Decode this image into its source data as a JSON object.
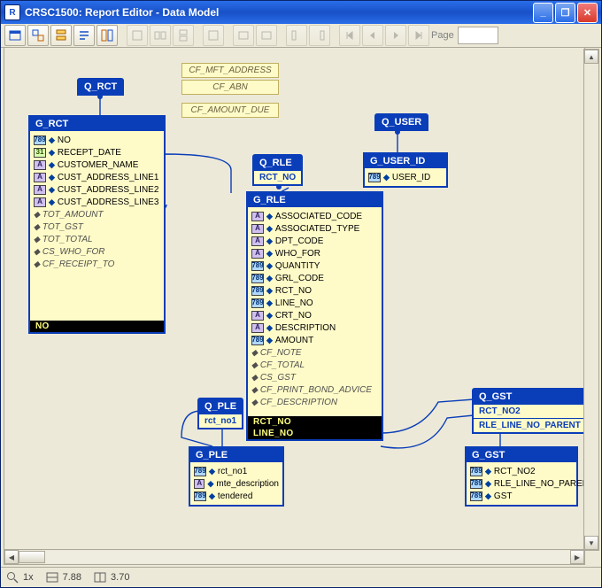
{
  "window": {
    "title": "CRSC1500: Report Editor - Data Model"
  },
  "toolbar": {
    "page_label": "Page"
  },
  "fields": {
    "f1": "CF_MFT_ADDRESS",
    "f2": "CF_ABN",
    "f3": "CF_AMOUNT_DUE"
  },
  "q_rct": {
    "title": "Q_RCT"
  },
  "g_rct": {
    "title": "G_RCT",
    "cols": [
      {
        "t": "num",
        "n": "NO"
      },
      {
        "t": "date",
        "n": "RECEPT_DATE"
      },
      {
        "t": "str",
        "n": "CUSTOMER_NAME"
      },
      {
        "t": "str",
        "n": "CUST_ADDRESS_LINE1"
      },
      {
        "t": "str",
        "n": "CUST_ADDRESS_LINE2"
      },
      {
        "t": "str",
        "n": "CUST_ADDRESS_LINE3"
      }
    ],
    "formulas": [
      "TOT_AMOUNT",
      "TOT_GST",
      "TOT_TOTAL",
      "CS_WHO_FOR",
      "CF_RECEIPT_TO"
    ],
    "foot": "NO"
  },
  "q_rle": {
    "title": "Q_RLE",
    "param": "RCT_NO"
  },
  "g_rle": {
    "title": "G_RLE",
    "cols": [
      {
        "t": "str",
        "n": "ASSOCIATED_CODE"
      },
      {
        "t": "str",
        "n": "ASSOCIATED_TYPE"
      },
      {
        "t": "str",
        "n": "DPT_CODE"
      },
      {
        "t": "str",
        "n": "WHO_FOR"
      },
      {
        "t": "num",
        "n": "QUANTITY"
      },
      {
        "t": "num",
        "n": "GRL_CODE"
      },
      {
        "t": "num",
        "n": "RCT_NO"
      },
      {
        "t": "num",
        "n": "LINE_NO"
      },
      {
        "t": "str",
        "n": "CRT_NO"
      },
      {
        "t": "str",
        "n": "DESCRIPTION"
      },
      {
        "t": "num",
        "n": "AMOUNT"
      }
    ],
    "formulas": [
      "CF_NOTE",
      "CF_TOTAL",
      "CS_GST",
      "CF_PRINT_BOND_ADVICE",
      "CF_DESCRIPTION"
    ],
    "foot1": "RCT_NO",
    "foot2": "LINE_NO"
  },
  "q_ple": {
    "title": "Q_PLE",
    "param": "rct_no1"
  },
  "g_ple": {
    "title": "G_PLE",
    "cols": [
      {
        "t": "num",
        "n": "rct_no1"
      },
      {
        "t": "str",
        "n": "mte_description"
      },
      {
        "t": "num",
        "n": "tendered"
      }
    ]
  },
  "q_user": {
    "title": "Q_USER"
  },
  "g_user": {
    "title": "G_USER_ID",
    "cols": [
      {
        "t": "num",
        "n": "USER_ID"
      }
    ]
  },
  "q_gst": {
    "title": "Q_GST",
    "param1": "RCT_NO2",
    "param2": "RLE_LINE_NO_PARENT"
  },
  "g_gst": {
    "title": "G_GST",
    "cols": [
      {
        "t": "num",
        "n": "RCT_NO2"
      },
      {
        "t": "num",
        "n": "RLE_LINE_NO_PARENT"
      },
      {
        "t": "num",
        "n": "GST"
      }
    ]
  },
  "status": {
    "zoom": "1x",
    "x": "7.88",
    "y": "3.70"
  }
}
